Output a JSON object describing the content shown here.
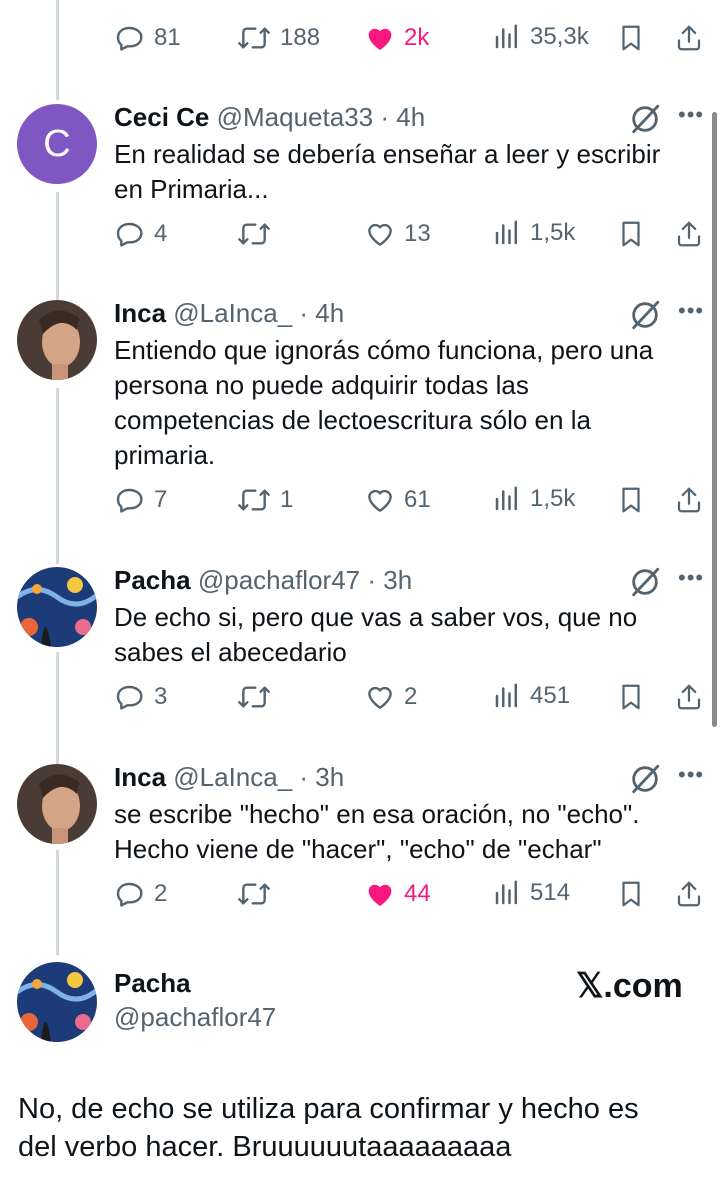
{
  "top_actions": {
    "replies": "81",
    "reposts": "188",
    "likes": "2k",
    "views": "35,3k",
    "liked": true
  },
  "tweets": [
    {
      "avatar_letter": "C",
      "name": "Ceci Ce",
      "handle": "@Maqueta33",
      "time": "· 4h",
      "lines": [
        "En realidad se debería enseñar a leer y escribir",
        "en Primaria..."
      ],
      "replies": "4",
      "reposts": "",
      "likes": "13",
      "views": "1,5k",
      "liked": false
    },
    {
      "name": "Inca",
      "handle": "@LaInca_",
      "time": "· 4h",
      "lines": [
        "Entiendo que ignorás cómo funciona, pero una",
        "persona no puede adquirir todas las",
        "competencias de lectoescritura sólo en la",
        "primaria."
      ],
      "replies": "7",
      "reposts": "1",
      "likes": "61",
      "views": "1,5k",
      "liked": false
    },
    {
      "name": "Pacha",
      "handle": "@pachaflor47",
      "time": "· 3h",
      "lines": [
        "De echo si, pero que vas a saber vos,  que no",
        "sabes el abecedario"
      ],
      "replies": "3",
      "reposts": "",
      "likes": "2",
      "views": "451",
      "liked": false
    },
    {
      "name": "Inca",
      "handle": "@LaInca_",
      "time": "· 3h",
      "lines": [
        "se escribe \"hecho\" en esa oración, no \"echo\".",
        "Hecho viene de \"hacer\", \"echo\" de \"echar\""
      ],
      "replies": "2",
      "reposts": "",
      "likes": "44",
      "views": "514",
      "liked": true
    }
  ],
  "final": {
    "name": "Pacha",
    "handle": "@pachaflor47",
    "site": "𝕏.com",
    "lines": [
      "No, de echo se utiliza para confirmar y hecho es",
      "del verbo hacer. Bruuuuuutaaaaaaaaa"
    ]
  },
  "colors": {
    "accent_like": "#f91880",
    "muted": "#536471",
    "avatar_c": "#7e57c2"
  }
}
